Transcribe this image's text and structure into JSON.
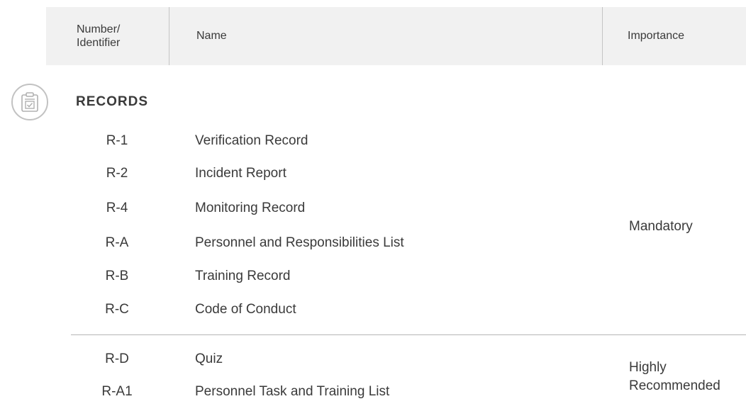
{
  "header": {
    "number_label": "Number/\nIdentifier",
    "name_label": "Name",
    "importance_label": "Importance"
  },
  "section": {
    "icon": "clipboard-check-icon",
    "title": "RECORDS"
  },
  "groups": [
    {
      "importance": "Mandatory",
      "rows": [
        {
          "id": "R-1",
          "name": "Verification Record"
        },
        {
          "id": "R-2",
          "name": "Incident Report"
        },
        {
          "id": "R-4",
          "name": "Monitoring Record"
        },
        {
          "id": "R-A",
          "name": "Personnel and Responsibilities List"
        },
        {
          "id": "R-B",
          "name": "Training Record"
        },
        {
          "id": "R-C",
          "name": "Code of Conduct"
        }
      ]
    },
    {
      "importance_line1": "Highly",
      "importance_line2": "Recommended",
      "rows": [
        {
          "id": "R-D",
          "name": "Quiz"
        },
        {
          "id": "R-A1",
          "name": "Personnel Task and Training List"
        }
      ]
    }
  ],
  "colors": {
    "header_bg": "#f1f1f1",
    "text": "#3a3a3a",
    "divider": "#b5b5b5"
  }
}
